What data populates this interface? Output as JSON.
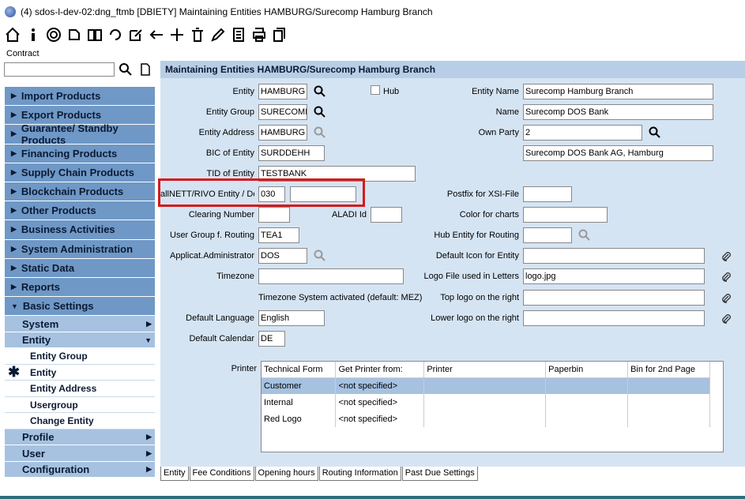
{
  "window": {
    "title": "(4) sdos-l-dev-02:dng_ftmb [DBIETY] Maintaining Entities HAMBURG/Surecomp Hamburg Branch"
  },
  "toolbar": {
    "icons": [
      "home-icon",
      "info-icon",
      "target-icon",
      "pin-icon",
      "book-icon",
      "refresh-icon",
      "edit-icon",
      "back-arrow-icon",
      "add-icon",
      "delete-icon",
      "pencil-icon",
      "report-icon",
      "print-icon",
      "copy-icon"
    ]
  },
  "contract": {
    "label": "Contract",
    "value": ""
  },
  "sidebar": {
    "items": [
      {
        "label": "Import Products"
      },
      {
        "label": "Export Products"
      },
      {
        "label": "Guarantee/ Standby Products"
      },
      {
        "label": "Financing Products"
      },
      {
        "label": "Supply Chain Products"
      },
      {
        "label": "Blockchain Products"
      },
      {
        "label": "Other Products"
      },
      {
        "label": "Business Activities"
      },
      {
        "label": "System Administration"
      },
      {
        "label": "Static Data"
      },
      {
        "label": "Reports"
      },
      {
        "label": "Basic Settings"
      }
    ],
    "sub": {
      "system": "System",
      "entity": "Entity",
      "profile": "Profile",
      "user": "User",
      "configuration": "Configuration"
    },
    "leaves": [
      "Entity Group",
      "Entity",
      "Entity Address",
      "Usergroup",
      "Change Entity"
    ]
  },
  "header": {
    "title": "Maintaining Entities HAMBURG/Surecomp Hamburg Branch"
  },
  "form": {
    "entity_label": "Entity",
    "entity_value": "HAMBURG",
    "hub_label": "Hub",
    "entity_name_label": "Entity Name",
    "entity_name_value": "Surecomp Hamburg Branch",
    "entity_group_label": "Entity Group",
    "entity_group_value": "SURECOMP",
    "name_label": "Name",
    "name_value": "Surecomp DOS Bank",
    "entity_address_label": "Entity Address",
    "entity_address_value": "HAMBURG",
    "own_party_label": "Own Party",
    "own_party_value": "2",
    "bic_label": "BIC of Entity",
    "bic_value": "SURDDEHH",
    "own_party_name_value": "Surecomp DOS Bank AG, Hamburg",
    "tid_label": "TID of Entity",
    "tid_value": "TESTBANK",
    "allnett_label": "allNETT/RIVO Entity / Dept.",
    "allnett_value": "030",
    "dept_value": "",
    "postfix_label": "Postfix for XSI-File",
    "postfix_value": "",
    "clearing_label": "Clearing Number",
    "clearing_value": "",
    "aladi_label": "ALADI Id",
    "aladi_value": "",
    "color_label": "Color for charts",
    "color_value": "",
    "usergroup_label": "User Group f. Routing",
    "usergroup_value": "TEA1",
    "hub_routing_label": "Hub Entity for Routing",
    "hub_routing_value": "",
    "appadmin_label": "Applicat.Administrator",
    "appadmin_value": "DOS",
    "default_icon_label": "Default Icon for Entity",
    "default_icon_value": "",
    "timezone_label": "Timezone",
    "timezone_value": "",
    "logo_file_label": "Logo File used in Letters",
    "logo_file_value": "logo.jpg",
    "timezone_note": "Timezone System activated (default: MEZ)",
    "top_logo_label": "Top logo on the right",
    "top_logo_value": "",
    "default_lang_label": "Default Language",
    "default_lang_value": "English",
    "lower_logo_label": "Lower logo on the right",
    "lower_logo_value": "",
    "default_cal_label": "Default Calendar",
    "default_cal_value": "DE",
    "printer_label": "Printer"
  },
  "printer_table": {
    "columns": [
      "Technical Form",
      "Get Printer from:",
      "Printer",
      "Paperbin",
      "Bin for 2nd Page"
    ],
    "rows": [
      [
        "Customer",
        "<not specified>",
        "",
        "",
        ""
      ],
      [
        "Internal",
        "<not specified>",
        "",
        "",
        ""
      ],
      [
        "Red Logo",
        "<not specified>",
        "",
        "",
        ""
      ]
    ]
  },
  "tabs": [
    "Entity",
    "Fee Conditions",
    "Opening hours",
    "Routing Information",
    "Past Due Settings"
  ]
}
